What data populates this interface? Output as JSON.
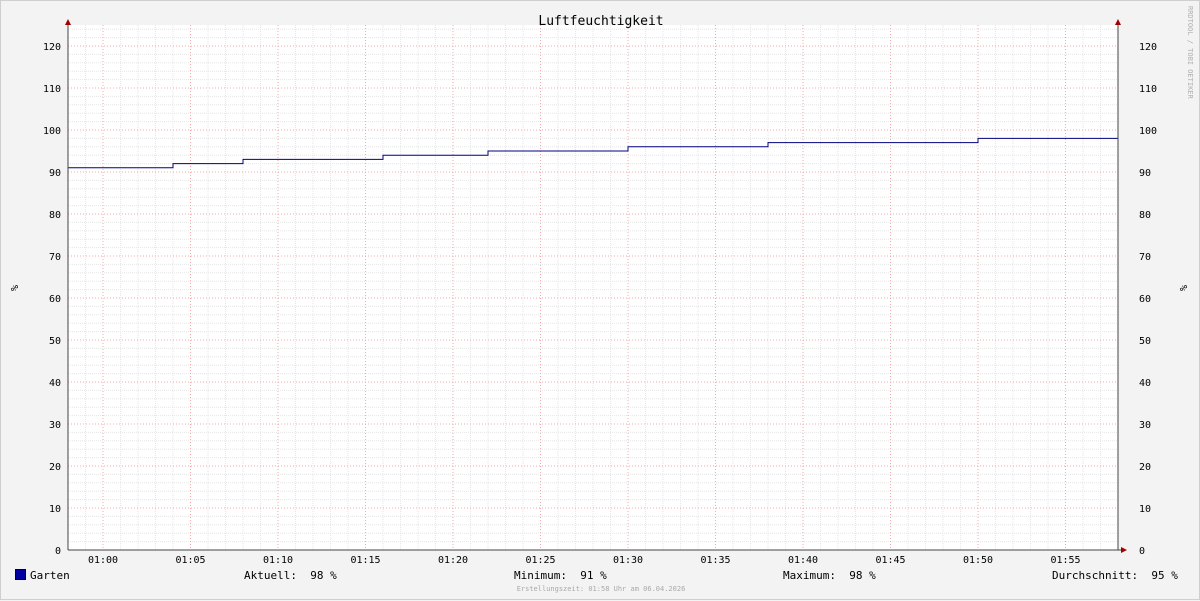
{
  "chart_data": {
    "type": "line",
    "title": "Luftfeuchtigkeit",
    "ylabel": "%",
    "ylabel_right": "%",
    "ylim": [
      0,
      125
    ],
    "yticks": [
      0,
      10,
      20,
      30,
      40,
      50,
      60,
      70,
      80,
      90,
      100,
      110,
      120
    ],
    "xlim": [
      "00:58",
      "01:58"
    ],
    "xticks": [
      "01:00",
      "01:05",
      "01:10",
      "01:15",
      "01:20",
      "01:25",
      "01:30",
      "01:35",
      "01:40",
      "01:45",
      "01:50",
      "01:55"
    ],
    "grid": true,
    "series": [
      {
        "name": "Garten",
        "color": "#000080",
        "step": true,
        "points": [
          [
            "00:58",
            91
          ],
          [
            "01:04",
            92
          ],
          [
            "01:08",
            93
          ],
          [
            "01:16",
            94
          ],
          [
            "01:22",
            95
          ],
          [
            "01:30",
            96
          ],
          [
            "01:38",
            97
          ],
          [
            "01:50",
            98
          ],
          [
            "01:58",
            98
          ]
        ]
      }
    ],
    "watermark": "RRDTOOL / TOBI OETIKER"
  },
  "legend": {
    "swatch_color": "#0000a0",
    "series_label": "Garten",
    "current": "Aktuell:  98 %",
    "minimum": "Minimum:  91 %",
    "maximum": "Maximum:  98 %",
    "average": "Durchschnitt:  95 %"
  },
  "footer": "Erstellungszeit: 01:58 Uhr am 06.04.2026"
}
